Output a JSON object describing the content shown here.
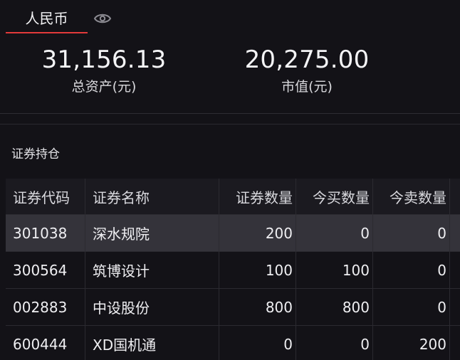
{
  "tabs": {
    "currency_label": "人民币",
    "visibility_icon": "eye-icon"
  },
  "summary": {
    "total_assets_value": "31,156.13",
    "total_assets_label": "总资产(元)",
    "market_value_value": "20,275.00",
    "market_value_label": "市值(元)"
  },
  "positions": {
    "title": "证券持仓",
    "columns": [
      "证券代码",
      "证券名称",
      "证券数量",
      "今买数量",
      "今卖数量"
    ],
    "rows": [
      [
        "301038",
        "深水规院",
        "200",
        "0",
        "0"
      ],
      [
        "300564",
        "筑博设计",
        "100",
        "100",
        "0"
      ],
      [
        "002883",
        "中设股份",
        "800",
        "800",
        "0"
      ],
      [
        "600444",
        "XD国机通",
        "0",
        "0",
        "200"
      ]
    ]
  },
  "colors": {
    "background": "#131217",
    "accent_underline": "#e23a3a",
    "selected_row": "#34333a"
  }
}
